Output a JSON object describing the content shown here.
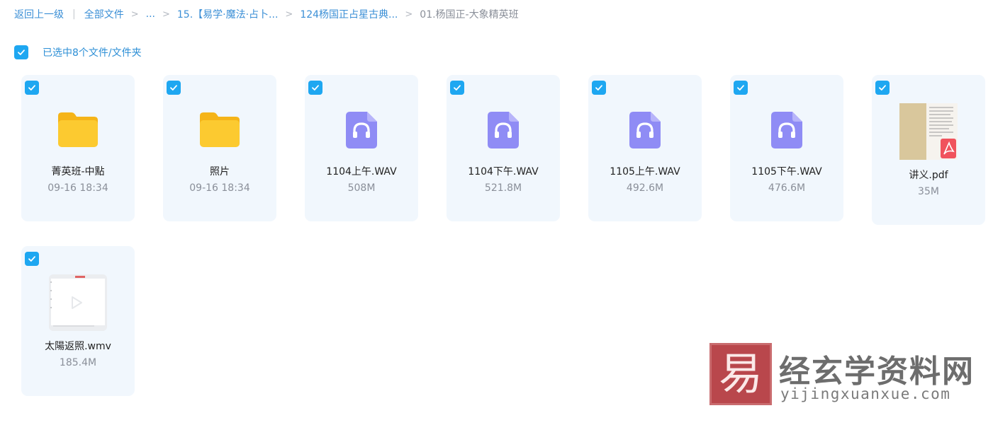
{
  "breadcrumb": {
    "back": "返回上一级",
    "all_files": "全部文件",
    "ellipsis": "...",
    "folder1": "15.【易学·魔法·占卜...",
    "folder2": "124杨国正占星古典...",
    "current": "01.杨国正-大象精英班"
  },
  "selection": {
    "label": "已选中8个文件/文件夹"
  },
  "files": [
    {
      "name": "菁英班-中點",
      "meta": "09-16 18:34",
      "type": "folder"
    },
    {
      "name": "照片",
      "meta": "09-16 18:34",
      "type": "folder"
    },
    {
      "name": "1104上午.WAV",
      "meta": "508M",
      "type": "audio"
    },
    {
      "name": "1104下午.WAV",
      "meta": "521.8M",
      "type": "audio"
    },
    {
      "name": "1105上午.WAV",
      "meta": "492.6M",
      "type": "audio"
    },
    {
      "name": "1105下午.WAV",
      "meta": "476.6M",
      "type": "audio"
    },
    {
      "name": "讲义.pdf",
      "meta": "35M",
      "type": "pdf"
    },
    {
      "name": "太陽返照.wmv",
      "meta": "185.4M",
      "type": "video"
    }
  ],
  "watermark": {
    "logo_glyph": "易",
    "title": "经玄学资料网",
    "url": "yijingxuanxue.com"
  },
  "colors": {
    "accent": "#1ea7f1",
    "link": "#3b8fd6",
    "card_bg": "#f1f7fd",
    "audio_icon": "#8f8cf5",
    "folder_icon": "#fbc52c"
  }
}
